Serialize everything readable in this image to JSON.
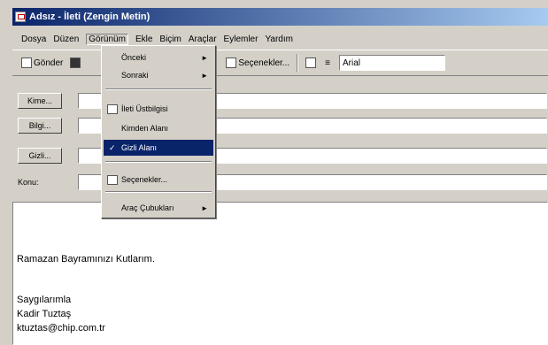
{
  "window": {
    "title": "Adsız - İleti (Zengin Metin)"
  },
  "menu": {
    "items": [
      "Dosya",
      "Düzen",
      "Görünüm",
      "Ekle",
      "Biçim",
      "Araçlar",
      "Eylemler",
      "Yardım"
    ],
    "active_index": 2
  },
  "toolbar": {
    "send_label": "Gönder",
    "options_label": "Seçenekler...",
    "font_name": "Arial"
  },
  "fields": {
    "to_label": "Kime...",
    "cc_label": "Bilgi...",
    "bcc_label": "Gizli...",
    "subject_label": "Konu:"
  },
  "view_menu": {
    "previous": "Önceki",
    "next": "Sonraki",
    "message_header": "İleti Üstbilgisi",
    "from_field": "Kimden Alanı",
    "bcc_field": "Gizli Alanı",
    "options": "Seçenekler...",
    "toolbars": "Araç Çubukları"
  },
  "body": {
    "line1": "Ramazan Bayramınızı Kutlarım.",
    "line2": "Saygılarımla",
    "line3": "Kadir Tuztaş",
    "line4": "ktuztas@chip.com.tr"
  }
}
